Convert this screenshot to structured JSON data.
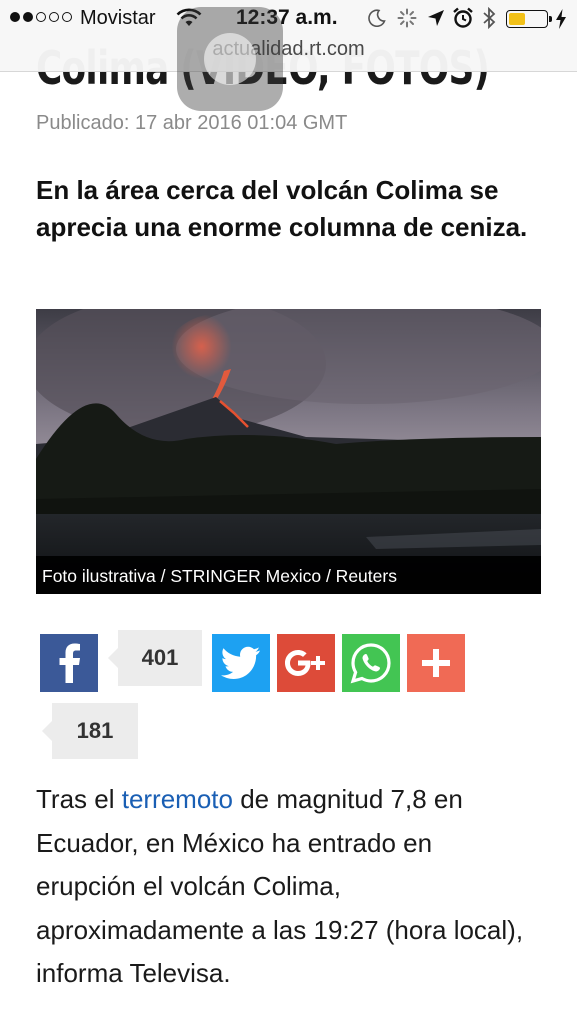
{
  "status_bar": {
    "carrier": "Movistar",
    "time": "12:37 a.m.",
    "signal_bars_filled": 2,
    "signal_bars_total": 5,
    "battery_level": 0.4,
    "battery_color": "#f2c118"
  },
  "browser": {
    "url": "actualidad.rt.com"
  },
  "article": {
    "headline_fragment": "Colima (VIDEO, FOTOS)",
    "published": "Publicado: 17 abr 2016 01:04 GMT",
    "subheadline": "En la área cerca del volcán Colima se aprecia una enorme columna de ceniza.",
    "photo_caption": "Foto ilustrativa  /  STRINGER Mexico / Reuters",
    "body": {
      "before_link": "Tras el ",
      "link_text": "terremoto",
      "after_link": " de magnitud 7,8 en Ecuador, en México ha entrado en erupción el volcán Colima, aproximadamente a las 19:27 (hora local), informa Televisa."
    }
  },
  "share": {
    "facebook_count": "401",
    "second_count": "181",
    "colors": {
      "facebook": "#3b5998",
      "twitter": "#1da1f2",
      "google_plus": "#dd4b39",
      "whatsapp": "#43c553",
      "more": "#f06a55"
    },
    "icons": [
      "facebook-icon",
      "twitter-icon",
      "google-plus-icon",
      "whatsapp-icon",
      "plus-icon"
    ]
  }
}
